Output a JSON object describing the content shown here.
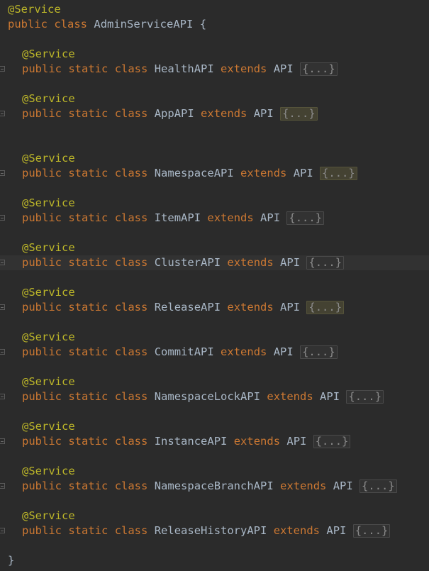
{
  "code": {
    "outer_annotation": "@Service",
    "outer_public": "public",
    "outer_class_kw": "class",
    "outer_class_name": "AdminServiceAPI",
    "outer_open_brace": "{",
    "closing_brace": "}",
    "fold_placeholder": "{...}",
    "inner_annotation": "@Service",
    "kw_public": "public",
    "kw_static": "static",
    "kw_class": "class",
    "kw_extends": "extends",
    "parent_class": "API",
    "inner_classes": [
      {
        "name": "HealthAPI"
      },
      {
        "name": "AppAPI"
      },
      {
        "name": "NamespaceAPI"
      },
      {
        "name": "ItemAPI"
      },
      {
        "name": "ClusterAPI"
      },
      {
        "name": "ReleaseAPI"
      },
      {
        "name": "CommitAPI"
      },
      {
        "name": "NamespaceLockAPI"
      },
      {
        "name": "InstanceAPI"
      },
      {
        "name": "NamespaceBranchAPI"
      },
      {
        "name": "ReleaseHistoryAPI"
      }
    ]
  },
  "colors": {
    "background": "#2b2b2b",
    "annotation": "#bbb529",
    "keyword": "#cc7832",
    "identifier": "#a9b7c6",
    "current_line": "#323232"
  }
}
